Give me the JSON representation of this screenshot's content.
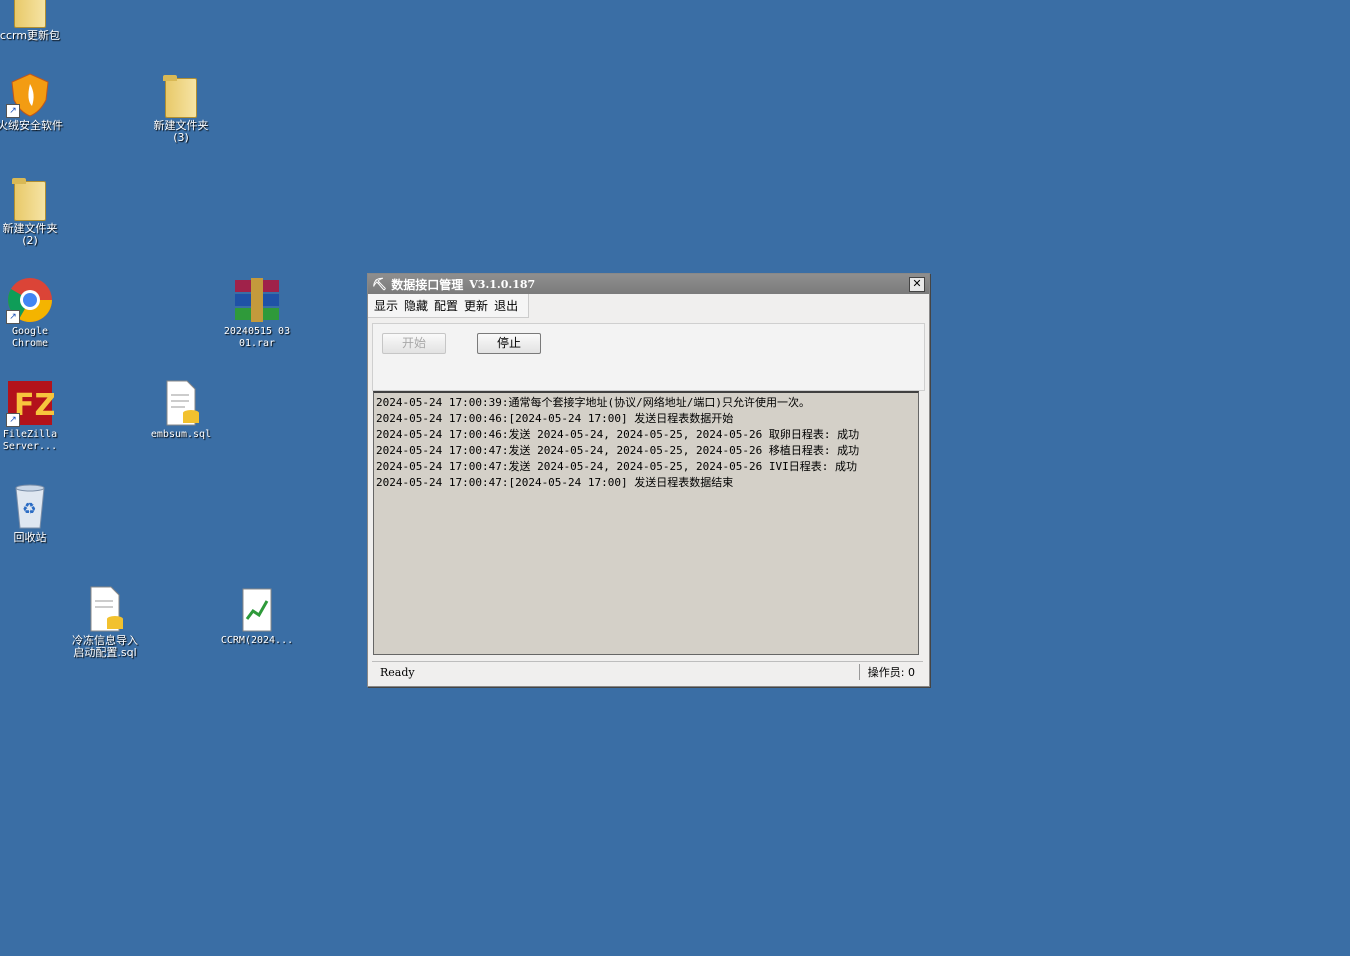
{
  "desktop": {
    "icons": [
      {
        "id": "ccrm-update",
        "label": "ccrm更新包"
      },
      {
        "id": "security",
        "label": "火绒安全软件"
      },
      {
        "id": "new-folder-3",
        "label": "新建文件夹\n(3)"
      },
      {
        "id": "new-folder-2",
        "label": "新建文件夹\n(2)"
      },
      {
        "id": "chrome",
        "label": "Google\nChrome"
      },
      {
        "id": "rar",
        "label": "20240515 03\n01.rar"
      },
      {
        "id": "filezilla",
        "label": "FileZilla\nServer..."
      },
      {
        "id": "embsum",
        "label": "embsum.sql"
      },
      {
        "id": "recycle",
        "label": "回收站"
      },
      {
        "id": "cold-sql",
        "label": "冷冻信息导入\n启动配置.sql"
      },
      {
        "id": "ccrm-2024",
        "label": "CCRM(2024..."
      }
    ]
  },
  "window": {
    "title": "数据接口管理",
    "version": "V3.1.0.187",
    "menu": [
      "显示",
      "隐藏",
      "配置",
      "更新",
      "退出"
    ],
    "buttons": {
      "start": "开始",
      "stop": "停止"
    },
    "log": [
      "2024-05-24 17:00:39:通常每个套接字地址(协议/网络地址/端口)只允许使用一次。",
      "2024-05-24 17:00:46:[2024-05-24 17:00] 发送日程表数据开始",
      "2024-05-24 17:00:46:发送 2024-05-24, 2024-05-25, 2024-05-26 取卵日程表: 成功",
      "2024-05-24 17:00:47:发送 2024-05-24, 2024-05-25, 2024-05-26 移植日程表: 成功",
      "2024-05-24 17:00:47:发送 2024-05-24, 2024-05-25, 2024-05-26 IVI日程表: 成功",
      "2024-05-24 17:00:47:[2024-05-24 17:00] 发送日程表数据结束"
    ],
    "status": "Ready",
    "operator_label": "操作员: 0"
  },
  "colors": {
    "desktop": "#3a6ea5"
  }
}
